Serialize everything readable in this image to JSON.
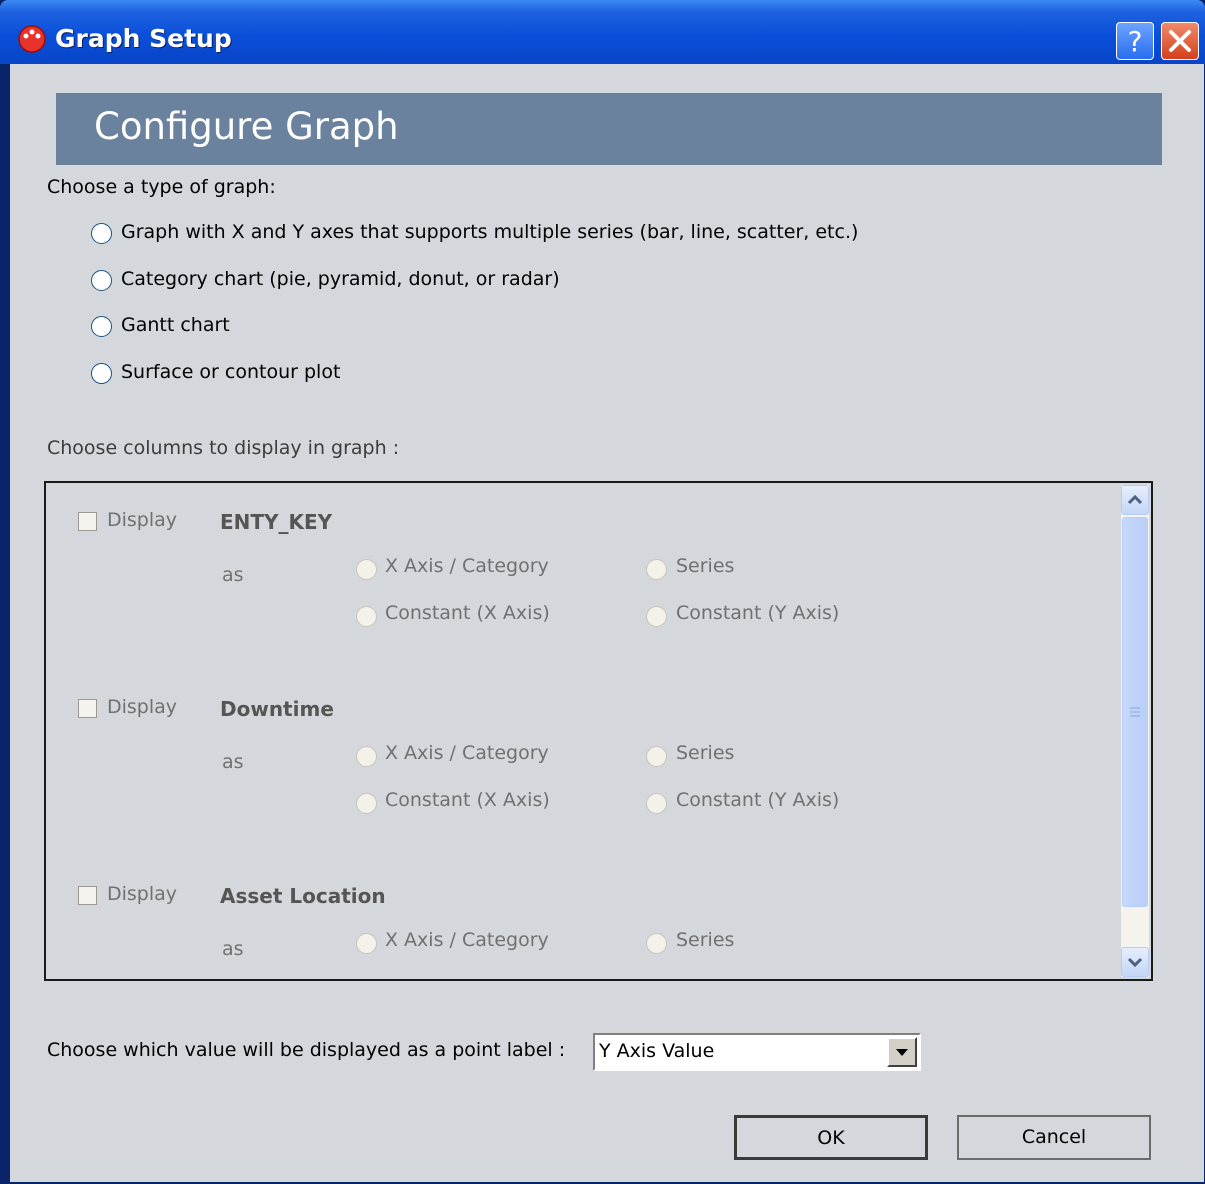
{
  "window": {
    "title": "Graph Setup",
    "header": "Configure Graph"
  },
  "graph_type": {
    "prompt": "Choose a type of graph:",
    "options": [
      "Graph with X and Y axes that supports multiple series (bar, line, scatter, etc.)",
      "Category chart (pie, pyramid, donut, or radar)",
      "Gantt chart",
      "Surface or contour plot"
    ]
  },
  "columns": {
    "prompt": "Choose columns to display in graph :",
    "display_label": "Display",
    "as_label": "as",
    "role_options": [
      "X Axis / Category",
      "Series",
      "Constant (X Axis)",
      "Constant (Y Axis)"
    ],
    "items": [
      "ENTY_KEY",
      "Downtime",
      "Asset Location"
    ]
  },
  "point_label": {
    "prompt": "Choose which value will be displayed as a point label :",
    "selected": "Y Axis Value"
  },
  "buttons": {
    "ok": "OK",
    "cancel": "Cancel"
  },
  "colors": {
    "titlebar": "#0a4fd9",
    "header_band": "#6a829e",
    "dialog_bg": "#d4d8dc"
  },
  "icons": [
    "app-icon",
    "help-icon",
    "close-icon",
    "scroll-up-icon",
    "scroll-down-icon",
    "dropdown-arrow-icon"
  ]
}
